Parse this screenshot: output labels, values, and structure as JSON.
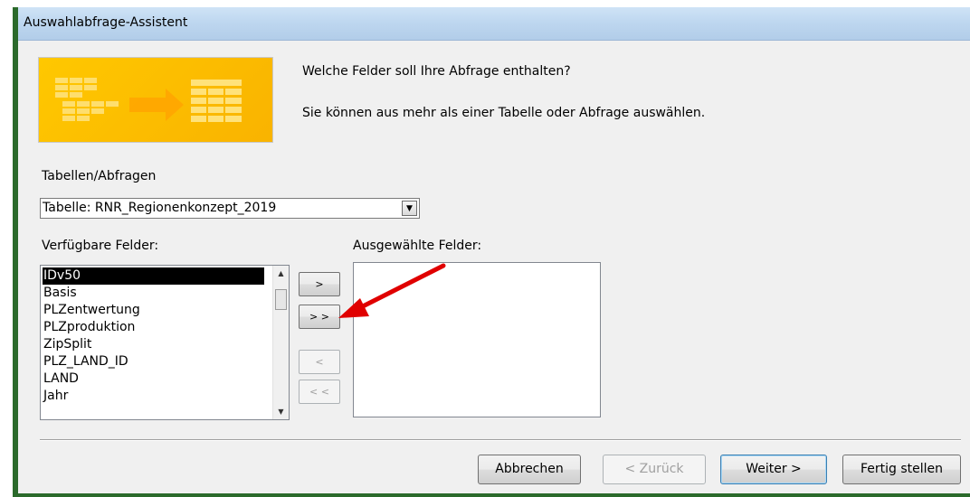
{
  "window": {
    "title": "Auswahlabfrage-Assistent"
  },
  "prompt": {
    "line1": "Welche Felder soll Ihre Abfrage enthalten?",
    "line2": "Sie können aus mehr als einer Tabelle oder Abfrage auswählen."
  },
  "tables": {
    "label": "Tabellen/Abfragen",
    "selected": "Tabelle: RNR_Regionenkonzept_2019"
  },
  "available": {
    "label": "Verfügbare Felder:",
    "items": [
      "IDv50",
      "Basis",
      "PLZentwertung",
      "PLZproduktion",
      "ZipSplit",
      "PLZ_LAND_ID",
      "LAND",
      "Jahr"
    ],
    "selected_index": 0
  },
  "chosen": {
    "label": "Ausgewählte Felder:",
    "items": []
  },
  "move": {
    "add_one": ">",
    "add_all": "> >",
    "remove_one": "<",
    "remove_all": "< <"
  },
  "buttons": {
    "cancel": "Abbrechen",
    "back": "< Zurück",
    "next": "Weiter >",
    "finish": "Fertig stellen"
  },
  "colors": {
    "annotation_arrow": "#e00000",
    "graphic": "#ffc000"
  }
}
